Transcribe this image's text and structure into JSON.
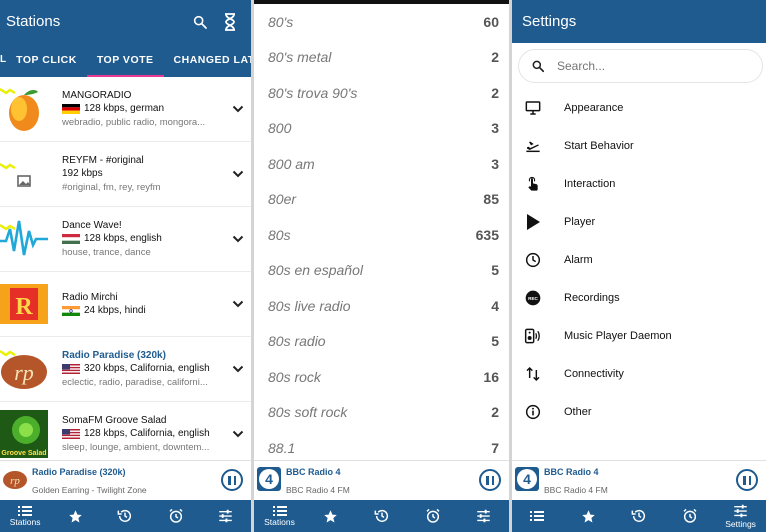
{
  "panel1": {
    "title": "Stations",
    "tab_edge": "L",
    "tabs": [
      "TOP CLICK",
      "TOP VOTE",
      "CHANGED LATE"
    ],
    "active_tab": 1,
    "stations": [
      {
        "name": "MANGORADIO",
        "meta": "128 kbps, german",
        "tags": "webradio, public radio, mongora...",
        "flag": "de",
        "highlight": false
      },
      {
        "name": "REYFM - #original",
        "meta": "192 kbps",
        "tags": "#original, fm, rey, reyfm",
        "flag": "",
        "highlight": false
      },
      {
        "name": "Dance Wave!",
        "meta": "128 kbps, english",
        "tags": "house, trance, dance",
        "flag": "hu",
        "highlight": false
      },
      {
        "name": "Radio Mirchi",
        "meta": "24 kbps, hindi",
        "tags": "",
        "flag": "in",
        "highlight": false
      },
      {
        "name": "Radio Paradise (320k)",
        "meta": "320 kbps, California, english",
        "tags": "eclectic, radio, paradise, californi...",
        "flag": "us",
        "highlight": true
      },
      {
        "name": "SomaFM Groove Salad",
        "meta": "128 kbps, California, english",
        "tags": "sleep, lounge, ambient, downtem...",
        "flag": "us",
        "highlight": false
      }
    ],
    "logo_texts": {
      "mirchi": "R",
      "paradise": "rp",
      "groove": "Groove Salad"
    },
    "player": {
      "title": "Radio Paradise (320k)",
      "subtitle": "Golden Earring - Twilight Zone",
      "logo_text": "rp"
    },
    "nav_label": "Stations"
  },
  "panel2": {
    "tags": [
      {
        "name": "80's",
        "count": "60"
      },
      {
        "name": "80's metal",
        "count": "2"
      },
      {
        "name": "80's trova 90's",
        "count": "2"
      },
      {
        "name": "800",
        "count": "3"
      },
      {
        "name": "800 am",
        "count": "3"
      },
      {
        "name": "80er",
        "count": "85"
      },
      {
        "name": "80s",
        "count": "635"
      },
      {
        "name": "80s en español",
        "count": "5"
      },
      {
        "name": "80s live radio",
        "count": "4"
      },
      {
        "name": "80s radio",
        "count": "5"
      },
      {
        "name": "80s rock",
        "count": "16"
      },
      {
        "name": "80s soft rock",
        "count": "2"
      },
      {
        "name": "88.1",
        "count": "7"
      }
    ],
    "player": {
      "title": "BBC Radio 4",
      "subtitle": "BBC Radio 4 FM",
      "logo_text": "4"
    },
    "nav_label": "Stations"
  },
  "panel3": {
    "title": "Settings",
    "search_placeholder": "Search...",
    "items": [
      {
        "label": "Appearance",
        "icon": "monitor-icon"
      },
      {
        "label": "Start Behavior",
        "icon": "flight-takeoff-icon"
      },
      {
        "label": "Interaction",
        "icon": "touch-app-icon"
      },
      {
        "label": "Player",
        "icon": "play-icon"
      },
      {
        "label": "Alarm",
        "icon": "clock-icon"
      },
      {
        "label": "Recordings",
        "icon": "rec-icon"
      },
      {
        "label": "Music Player Daemon",
        "icon": "speaker-icon"
      },
      {
        "label": "Connectivity",
        "icon": "swap-vert-icon"
      },
      {
        "label": "Other",
        "icon": "info-icon"
      }
    ],
    "rec_badge": "REC",
    "player": {
      "title": "BBC Radio 4",
      "subtitle": "BBC Radio 4 FM",
      "logo_text": "4"
    },
    "nav_label": "Settings"
  },
  "colors": {
    "primary": "#1f5b8f",
    "tab_indicator": "#e83a93",
    "text_muted": "#777777"
  }
}
